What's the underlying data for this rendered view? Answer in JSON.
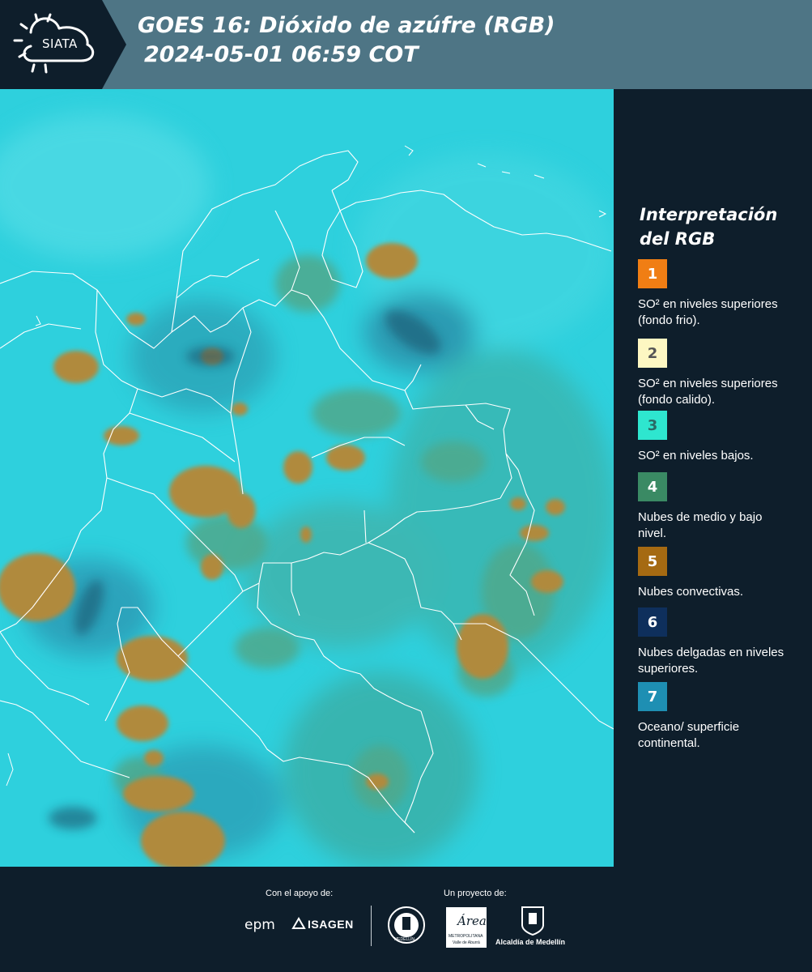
{
  "header": {
    "logo_text": "SIATA",
    "title_line1": "GOES 16: Dióxido de azúfre (RGB)",
    "title_line2": "2024-05-01 06:59 COT"
  },
  "legend": {
    "title": "Interpretación del RGB",
    "items": [
      {
        "number": "1",
        "label": "SO² en niveles superiores (fondo frio).",
        "color": "#f07e14",
        "text_color": "#ffffff"
      },
      {
        "number": "2",
        "label": "SO² en niveles superiores (fondo calido).",
        "color": "#fdf7c2",
        "text_color": "#555555"
      },
      {
        "number": "3",
        "label": "SO² en niveles bajos.",
        "color": "#2ee6cf",
        "text_color": "#2a6b66"
      },
      {
        "number": "4",
        "label": "Nubes de medio y bajo nivel.",
        "color": "#3a8a64",
        "text_color": "#ffffff"
      },
      {
        "number": "5",
        "label": "Nubes convectivas.",
        "color": "#a56a12",
        "text_color": "#ffffff"
      },
      {
        "number": "6",
        "label": "Nubes delgadas en niveles superiores.",
        "color": "#0e2f5c",
        "text_color": "#ffffff"
      },
      {
        "number": "7",
        "label": "Oceano/ superficie continental.",
        "color": "#1e8fb3",
        "text_color": "#ffffff"
      }
    ]
  },
  "map": {
    "background_color": "#2ed0dd",
    "cloud_color": "#b08a3c",
    "low_cloud_color": "#4fa98c",
    "border_color": "#ffffff"
  },
  "footer": {
    "support_caption": "Con el apoyo de:",
    "project_caption": "Un proyecto de:",
    "epm": "epm",
    "isagen": "ISAGEN",
    "metropolitana": "METROPOLITANA",
    "area_sub": "Valle de Aburrá",
    "area": "Área",
    "alcaldia": "Alcaldía de Medellín",
    "medellin_seal": "MEDELLÍN"
  }
}
